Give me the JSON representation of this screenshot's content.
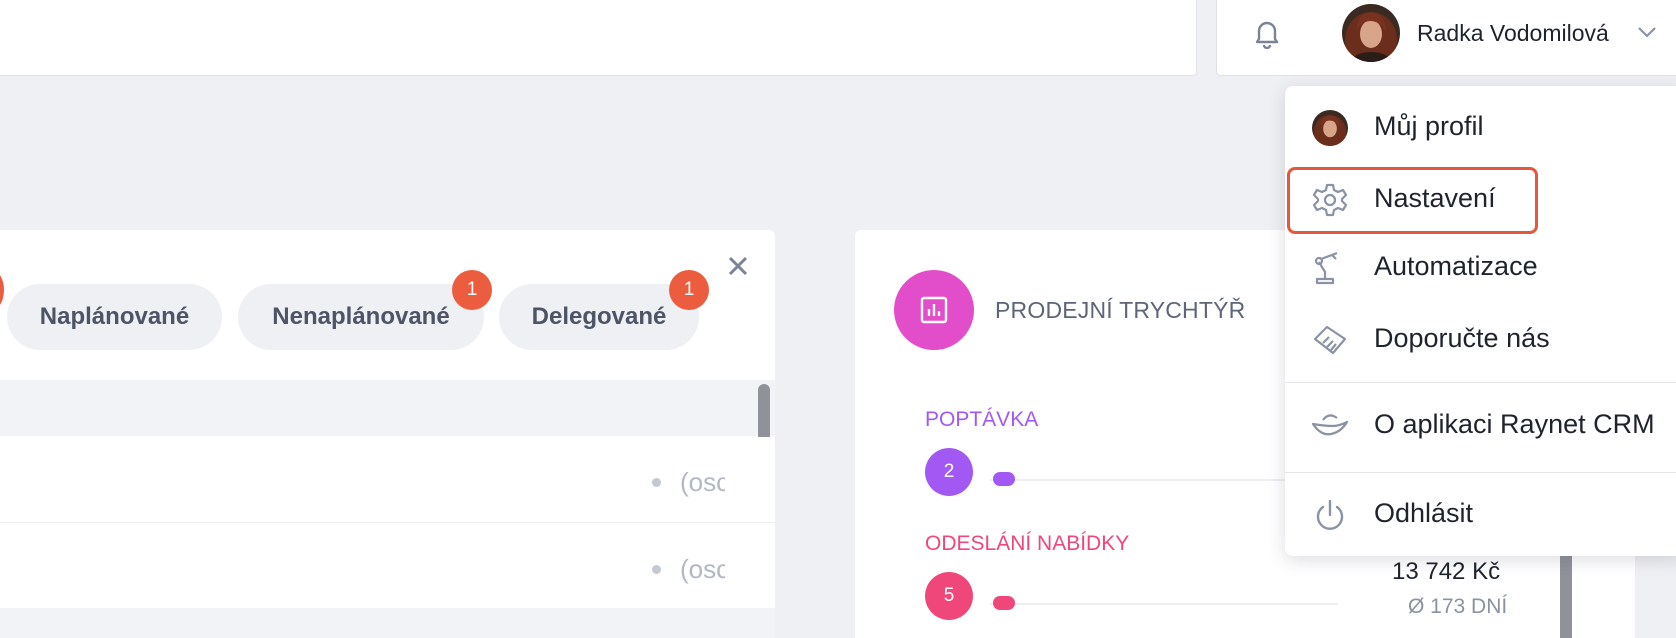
{
  "header": {
    "user_name": "Radka Vodomilová",
    "icons": {
      "notifications": "bell-icon",
      "menu": "chevron-down-icon"
    }
  },
  "tasks": {
    "tabs": [
      {
        "label": "Naplánované"
      },
      {
        "label": "Nenaplánované",
        "count": "1"
      },
      {
        "label": "Delegované",
        "count": "1"
      }
    ],
    "rows": [
      {
        "text": "(osc"
      },
      {
        "text": "(osc"
      }
    ]
  },
  "funnel": {
    "title": "PRODEJNÍ TRYCHTÝŘ",
    "stages": [
      {
        "label": "POPTÁVKA",
        "count": "2",
        "color": "#a259f4"
      },
      {
        "label": "ODESLÁNÍ NABÍDKY",
        "count": "5",
        "color": "#f0477a",
        "amount": "13 742 Kč",
        "days": "Ø 173 DNÍ"
      }
    ]
  },
  "user_menu": {
    "items": [
      {
        "label": "Můj profil",
        "icon": "avatar"
      },
      {
        "label": "Nastavení",
        "icon": "gear-icon",
        "highlighted": true
      },
      {
        "label": "Automatizace",
        "icon": "robot-arm-icon"
      },
      {
        "label": "Doporučte nás",
        "icon": "handshake-icon"
      },
      {
        "label": "O aplikaci Raynet CRM",
        "icon": "raynet-logo-icon"
      },
      {
        "label": "Odhlásit",
        "icon": "power-icon"
      }
    ],
    "highlight_color": "#e5573e"
  }
}
